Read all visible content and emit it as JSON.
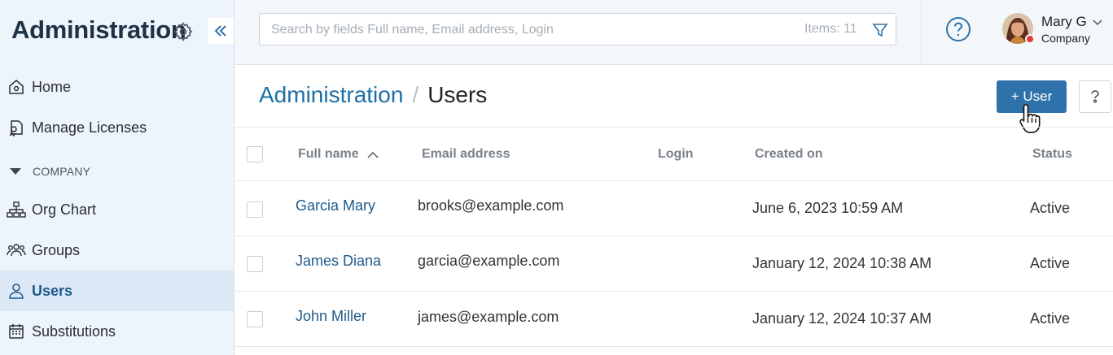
{
  "sidebar": {
    "title": "Administration",
    "items": [
      {
        "label": "Home",
        "icon": "home-icon"
      },
      {
        "label": "Manage Licenses",
        "icon": "license-icon"
      },
      {
        "label": "Org Chart",
        "icon": "org-chart-icon"
      },
      {
        "label": "Groups",
        "icon": "groups-icon"
      },
      {
        "label": "Users",
        "icon": "user-icon",
        "active": true
      },
      {
        "label": "Substitutions",
        "icon": "calendar-icon"
      }
    ],
    "section_label": "COMPANY"
  },
  "topbar": {
    "search_placeholder": "Search by fields Full name, Email address, Login",
    "items_count": "Items: 11",
    "user": {
      "name": "Mary G",
      "company": "Company",
      "status": "busy",
      "status_color": "#e53935"
    }
  },
  "page": {
    "breadcrumb_root": "Administration",
    "breadcrumb_sep": "/",
    "title": "Users",
    "add_button": "+ User",
    "accent": "#2f72ab",
    "link_color": "#1d6fa5"
  },
  "table": {
    "columns": [
      "Full name",
      "Email address",
      "Login",
      "Created on",
      "Status"
    ],
    "sorted_column": "Full name",
    "sort_direction": "ascending",
    "rows": [
      {
        "name": "Garcia Mary",
        "email": "brooks@example.com",
        "login": "",
        "created": "June 6, 2023 10:59 AM",
        "status": "Active"
      },
      {
        "name": "James Diana",
        "email": "garcia@example.com",
        "login": "",
        "created": "January 12, 2024 10:38 AM",
        "status": "Active"
      },
      {
        "name": "John Miller",
        "email": "james@example.com",
        "login": "",
        "created": "January 12, 2024 10:37 AM",
        "status": "Active"
      }
    ]
  }
}
